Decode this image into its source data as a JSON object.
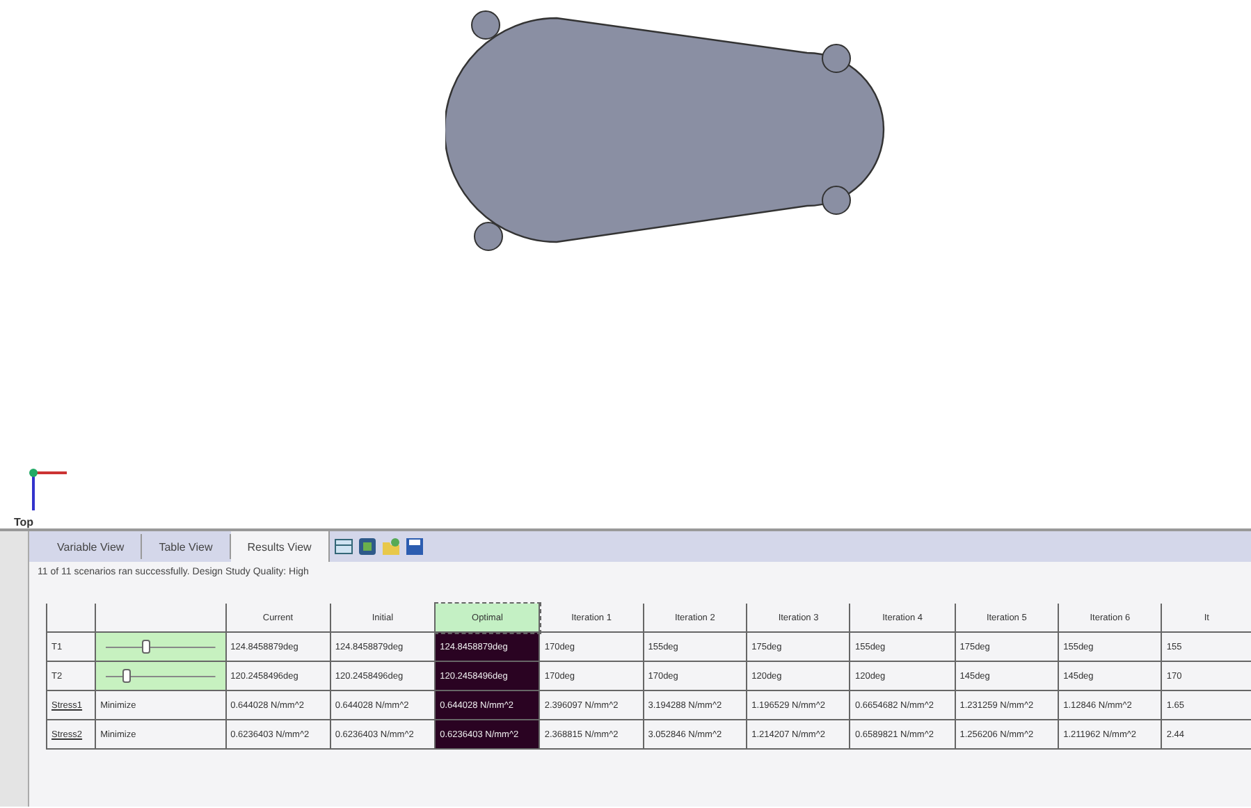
{
  "view_label": "Top",
  "tabs": [
    {
      "label": "Variable View",
      "selected": false
    },
    {
      "label": "Table View",
      "selected": false
    },
    {
      "label": "Results View",
      "selected": true
    }
  ],
  "status": "11 of 11 scenarios ran successfully. Design Study Quality: High",
  "table": {
    "columns": [
      {
        "label": "Current",
        "selected": false
      },
      {
        "label": "Initial",
        "selected": false
      },
      {
        "label": "Optimal",
        "selected": true
      },
      {
        "label": "Iteration 1",
        "selected": false
      },
      {
        "label": "Iteration 2",
        "selected": false
      },
      {
        "label": "Iteration 3",
        "selected": false
      },
      {
        "label": "Iteration 4",
        "selected": false
      },
      {
        "label": "Iteration 5",
        "selected": false
      },
      {
        "label": "Iteration 6",
        "selected": false
      },
      {
        "label": "It",
        "selected": false
      }
    ],
    "rows": [
      {
        "name": "T1",
        "kind": "slider",
        "level": 0.37,
        "values": [
          "124.8458879deg",
          "124.8458879deg",
          "124.8458879deg",
          "170deg",
          "155deg",
          "175deg",
          "155deg",
          "175deg",
          "155deg",
          "155"
        ]
      },
      {
        "name": "T2",
        "kind": "slider",
        "level": 0.19,
        "values": [
          "120.2458496deg",
          "120.2458496deg",
          "120.2458496deg",
          "170deg",
          "170deg",
          "120deg",
          "120deg",
          "145deg",
          "145deg",
          "170"
        ]
      },
      {
        "name": "Stress1",
        "kind": "goal",
        "goal": "Minimize",
        "values": [
          "0.644028 N/mm^2",
          "0.644028 N/mm^2",
          "0.644028 N/mm^2",
          "2.396097 N/mm^2",
          "3.194288 N/mm^2",
          "1.196529 N/mm^2",
          "0.6654682 N/mm^2",
          "1.231259 N/mm^2",
          "1.12846 N/mm^2",
          "1.65"
        ]
      },
      {
        "name": "Stress2",
        "kind": "goal",
        "goal": "Minimize",
        "values": [
          "0.6236403 N/mm^2",
          "0.6236403 N/mm^2",
          "0.6236403 N/mm^2",
          "2.368815 N/mm^2",
          "3.052846 N/mm^2",
          "1.214207 N/mm^2",
          "0.6589821 N/mm^2",
          "1.256206 N/mm^2",
          "1.211962 N/mm^2",
          "2.44"
        ]
      }
    ]
  }
}
